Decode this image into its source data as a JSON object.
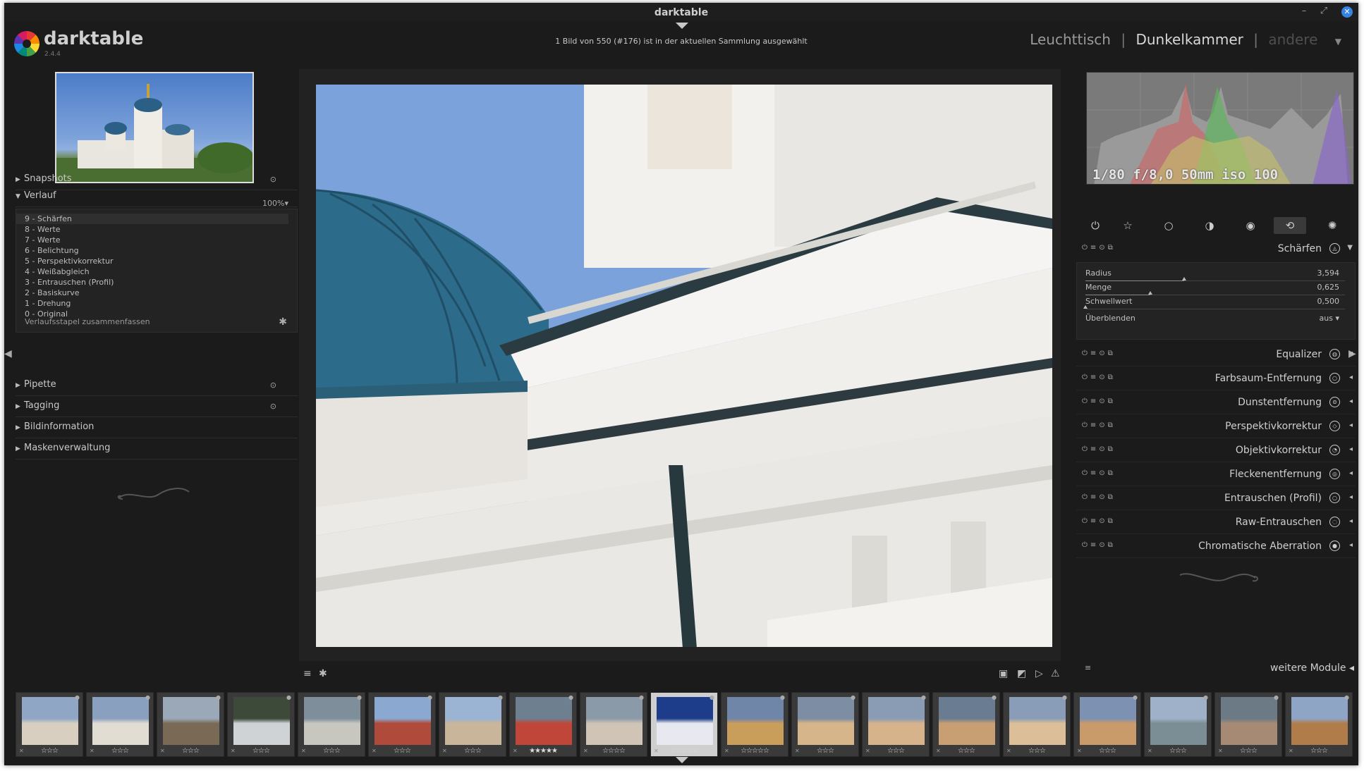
{
  "window": {
    "title": "darktable",
    "controls": [
      "–",
      "⤢",
      "✕"
    ]
  },
  "header": {
    "brand": "darktable",
    "version": "2.4.4",
    "selection_info": "1 Bild von 550 (#176) ist in der aktuellen Sammlung ausgewählt",
    "views": {
      "lighttable": "Leuchttisch",
      "darkroom": "Dunkelkammer",
      "other": "andere",
      "sep": "|"
    }
  },
  "left": {
    "zoom": "100%",
    "sections": {
      "snapshots": "Snapshots",
      "history": "Verlauf",
      "picker": "Pipette",
      "tagging": "Tagging",
      "image_info": "Bildinformation",
      "masks": "Maskenverwaltung"
    },
    "history_items": [
      "9 - Schärfen",
      "8 - Werte",
      "7 - Werte",
      "6 - Belichtung",
      "5 - Perspektivkorrektur",
      "4 - Weißabgleich",
      "3 - Entrauschen (Profil)",
      "2 - Basiskurve",
      "1 - Drehung",
      "0 - Original"
    ],
    "history_compress": "Verlaufsstapel zusammenfassen"
  },
  "right": {
    "exif": "1/80 f/8,0 50mm iso 100",
    "sharpen": {
      "name": "Schärfen",
      "radius_label": "Radius",
      "radius_value": "3,594",
      "radius_frac": 0.38,
      "amount_label": "Menge",
      "amount_value": "0,625",
      "amount_frac": 0.25,
      "threshold_label": "Schwellwert",
      "threshold_value": "0,500",
      "threshold_frac": 0.0,
      "blend_label": "Überblenden",
      "blend_value": "aus"
    },
    "modules": [
      "Equalizer",
      "Farbsaum-Entfernung",
      "Dunstentfernung",
      "Perspektivkorrektur",
      "Objektivkorrektur",
      "Fleckenentfernung",
      "Entrauschen (Profil)",
      "Raw-Entrauschen",
      "Chromatische Aberration"
    ],
    "more_modules": "weitere Module"
  },
  "filmstrip": {
    "ratings": [
      "☆☆☆",
      "☆☆☆",
      "☆☆☆",
      "☆☆☆",
      "☆☆☆",
      "☆☆☆",
      "☆☆☆",
      "★★★★★",
      "☆☆☆☆",
      "☆☆☆☆☆",
      "☆☆☆☆☆",
      "☆☆☆",
      "☆☆☆",
      "☆☆☆",
      "☆☆☆",
      "☆☆☆",
      "☆☆☆",
      "☆☆☆",
      "☆☆☆"
    ],
    "selected_index": 9
  },
  "colors": {
    "accent": "#3584e4",
    "panel_bg": "#1b1b1b",
    "sky": "#7aa0d8"
  }
}
